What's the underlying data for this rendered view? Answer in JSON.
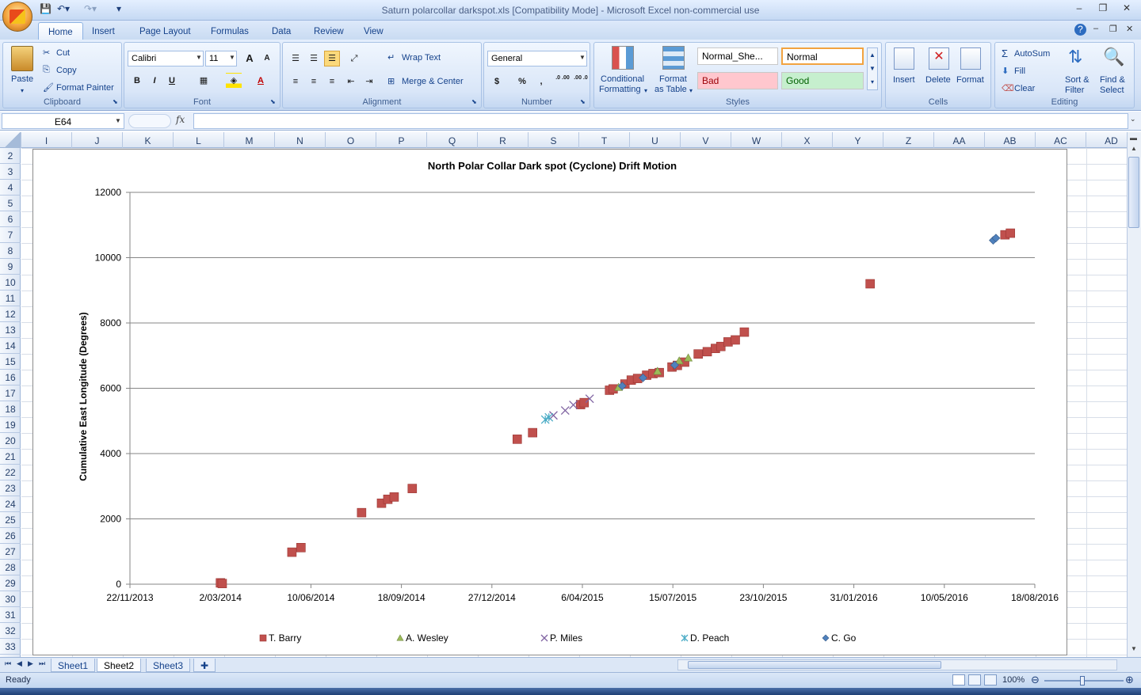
{
  "window": {
    "title": "Saturn polarcollar darkspot.xls  [Compatibility Mode] - Microsoft Excel non-commercial use"
  },
  "tabs": [
    "Home",
    "Insert",
    "Page Layout",
    "Formulas",
    "Data",
    "Review",
    "View"
  ],
  "ribbon": {
    "clipboard": {
      "paste": "Paste",
      "cut": "Cut",
      "copy": "Copy",
      "format_painter": "Format Painter",
      "label": "Clipboard"
    },
    "font": {
      "name": "Calibri",
      "size": "11",
      "bold": "B",
      "italic": "I",
      "underline": "U",
      "grow": "A",
      "shrink": "A",
      "font_color": "A",
      "label": "Font"
    },
    "alignment": {
      "wrap": "Wrap Text",
      "merge": "Merge & Center",
      "label": "Alignment"
    },
    "number": {
      "format": "General",
      "currency": "$",
      "percent": "%",
      "comma": ",",
      "inc_dec": ".0 .00",
      "dec_dec": ".00 .0",
      "label": "Number"
    },
    "styles": {
      "conditional": "Conditional",
      "conditional2": "Formatting",
      "table": "Format",
      "table2": "as Table",
      "normal_sheet": "Normal_She...",
      "normal": "Normal",
      "bad": "Bad",
      "good": "Good",
      "label": "Styles"
    },
    "cells": {
      "insert": "Insert",
      "delete": "Delete",
      "format": "Format",
      "label": "Cells"
    },
    "editing": {
      "autosum": "AutoSum",
      "fill": "Fill",
      "clear": "Clear",
      "sort": "Sort &",
      "sort2": "Filter",
      "find": "Find &",
      "find2": "Select",
      "label": "Editing"
    }
  },
  "formula_bar": {
    "name_box": "E64",
    "fx": "fx",
    "value": ""
  },
  "columns": [
    "I",
    "J",
    "K",
    "L",
    "M",
    "N",
    "O",
    "P",
    "Q",
    "R",
    "S",
    "T",
    "U",
    "V",
    "W",
    "X",
    "Y",
    "Z",
    "AA",
    "AB",
    "AC",
    "AD"
  ],
  "rows": [
    "2",
    "3",
    "4",
    "5",
    "6",
    "7",
    "8",
    "9",
    "10",
    "11",
    "12",
    "13",
    "14",
    "15",
    "16",
    "17",
    "18",
    "19",
    "20",
    "21",
    "22",
    "23",
    "24",
    "25",
    "26",
    "27",
    "28",
    "29",
    "30",
    "31",
    "32",
    "33"
  ],
  "sheets": [
    "Sheet1",
    "Sheet2",
    "Sheet3"
  ],
  "active_sheet": "Sheet2",
  "status": {
    "ready": "Ready",
    "zoom": "100%"
  },
  "chart_data": {
    "type": "scatter",
    "title": "North Polar Collar Dark spot (Cyclone) Drift Motion",
    "xlabel": "",
    "ylabel": "Cumulative East Longitude (Degrees)",
    "xlim": [
      "2013-11-22",
      "2016-08-18"
    ],
    "ylim": [
      0,
      12000
    ],
    "x_ticks": [
      "22/11/2013",
      "2/03/2014",
      "10/06/2014",
      "18/09/2014",
      "27/12/2014",
      "6/04/2015",
      "15/07/2015",
      "23/10/2015",
      "31/01/2016",
      "10/05/2016",
      "18/08/2016"
    ],
    "y_ticks": [
      "0",
      "2000",
      "4000",
      "6000",
      "8000",
      "10000",
      "12000"
    ],
    "grid": "horizontal",
    "legend": "bottom",
    "series": [
      {
        "name": "T. Barry",
        "marker": "square",
        "color": "#c0504d",
        "x": [
          "2014-03-02",
          "2014-03-04",
          "2014-05-20",
          "2014-05-30",
          "2014-08-05",
          "2014-08-27",
          "2014-09-03",
          "2014-09-10",
          "2014-09-30",
          "2015-01-24",
          "2015-02-10",
          "2015-04-04",
          "2015-04-08",
          "2015-05-06",
          "2015-05-10",
          "2015-05-23",
          "2015-05-30",
          "2015-06-06",
          "2015-06-16",
          "2015-06-23",
          "2015-06-30",
          "2015-07-14",
          "2015-07-20",
          "2015-07-28",
          "2015-08-12",
          "2015-08-22",
          "2015-08-31",
          "2015-09-06",
          "2015-09-14",
          "2015-09-22",
          "2015-10-02",
          "2016-02-18",
          "2016-07-16",
          "2016-07-22"
        ],
        "y": [
          40,
          20,
          980,
          1120,
          2190,
          2480,
          2600,
          2670,
          2930,
          4440,
          4640,
          5500,
          5560,
          5940,
          5980,
          6130,
          6250,
          6300,
          6400,
          6450,
          6480,
          6650,
          6700,
          6800,
          7050,
          7120,
          7220,
          7280,
          7420,
          7480,
          7720,
          9200,
          10700,
          10750
        ]
      },
      {
        "name": "A. Wesley",
        "marker": "triangle",
        "color": "#9bbb59",
        "x": [
          "2015-05-16",
          "2015-06-28",
          "2015-07-22",
          "2015-08-01"
        ],
        "y": [
          6030,
          6520,
          6840,
          6930
        ]
      },
      {
        "name": "P. Miles",
        "marker": "x",
        "color": "#8064a2",
        "x": [
          "2015-03-05",
          "2015-03-18",
          "2015-03-27",
          "2015-04-14"
        ],
        "y": [
          5170,
          5320,
          5490,
          5680
        ]
      },
      {
        "name": "D. Peach",
        "marker": "star",
        "color": "#4bacc6",
        "x": [
          "2015-02-24",
          "2015-02-28"
        ],
        "y": [
          5040,
          5110
        ]
      },
      {
        "name": "C. Go",
        "marker": "diamond",
        "color": "#4f81bd",
        "x": [
          "2015-05-20",
          "2015-06-12",
          "2015-07-17",
          "2016-07-03",
          "2016-07-06"
        ],
        "y": [
          6070,
          6320,
          6710,
          10530,
          10600
        ]
      }
    ]
  }
}
